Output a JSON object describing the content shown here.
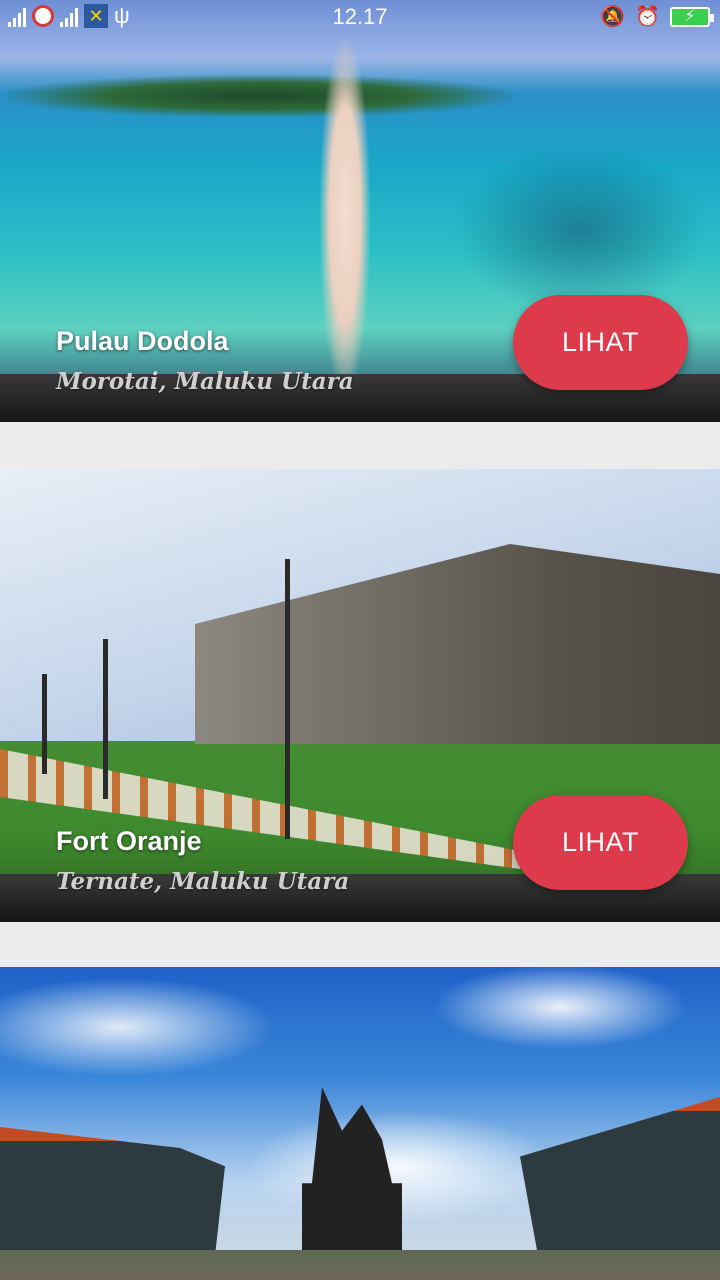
{
  "status_bar": {
    "time": "12.17",
    "usb_symbol": "ψ",
    "app_badge_symbol": "✕",
    "bell_off_symbol": "🔕",
    "alarm_symbol": "⏰",
    "charging_symbol": "⚡"
  },
  "destinations": [
    {
      "name": "Pulau Dodola",
      "location": "Morotai, Maluku Utara",
      "button_label": "LIHAT"
    },
    {
      "name": "Fort Oranje",
      "location": "Ternate, Maluku Utara",
      "button_label": "LIHAT"
    },
    {
      "name": "",
      "location": "",
      "button_label": ""
    }
  ],
  "colors": {
    "accent_button": "#dd3a4c",
    "page_background": "#ececec",
    "battery_fill": "#3ccf4e"
  }
}
